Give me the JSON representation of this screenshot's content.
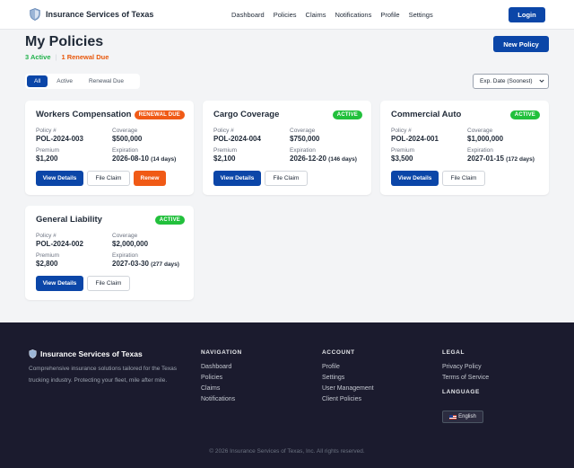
{
  "header": {
    "brand": "Insurance Services of Texas",
    "nav": [
      "Dashboard",
      "Policies",
      "Claims",
      "Notifications",
      "Profile",
      "Settings"
    ],
    "login_label": "Login"
  },
  "page": {
    "title": "My Policies",
    "active_count": "3 Active",
    "renewal_count": "1 Renewal Due",
    "new_policy_label": "New Policy"
  },
  "filters": {
    "tabs": [
      "All",
      "Active",
      "Renewal Due"
    ],
    "selected": "All",
    "sort_value": "Exp. Date (Soonest)"
  },
  "labels": {
    "policy_no": "Policy #",
    "coverage": "Coverage",
    "premium": "Premium",
    "expiration": "Expiration",
    "view_details": "View Details",
    "file_claim": "File Claim",
    "renew": "Renew"
  },
  "policies": [
    {
      "name": "Workers Compensation",
      "status": "RENEWAL DUE",
      "policy_no": "POL-2024-003",
      "coverage": "$500,000",
      "premium": "$1,200",
      "expiration": "2026-08-10",
      "days": "(14 days)"
    },
    {
      "name": "Cargo Coverage",
      "status": "ACTIVE",
      "policy_no": "POL-2024-004",
      "coverage": "$750,000",
      "premium": "$2,100",
      "expiration": "2026-12-20",
      "days": "(146 days)"
    },
    {
      "name": "Commercial Auto",
      "status": "ACTIVE",
      "policy_no": "POL-2024-001",
      "coverage": "$1,000,000",
      "premium": "$3,500",
      "expiration": "2027-01-15",
      "days": "(172 days)"
    },
    {
      "name": "General Liability",
      "status": "ACTIVE",
      "policy_no": "POL-2024-002",
      "coverage": "$2,000,000",
      "premium": "$2,800",
      "expiration": "2027-03-30",
      "days": "(277 days)"
    }
  ],
  "footer": {
    "brand": "Insurance Services of Texas",
    "description": "Comprehensive insurance solutions tailored for the Texas trucking industry. Protecting your fleet, mile after mile.",
    "navigation": {
      "heading": "NAVIGATION",
      "links": [
        "Dashboard",
        "Policies",
        "Claims",
        "Notifications"
      ]
    },
    "account": {
      "heading": "ACCOUNT",
      "links": [
        "Profile",
        "Settings",
        "User Management",
        "Client Policies"
      ]
    },
    "legal": {
      "heading": "LEGAL",
      "links": [
        "Privacy Policy",
        "Terms of Service"
      ]
    },
    "language": {
      "heading": "LANGUAGE",
      "button": "English"
    },
    "copyright": "© 2026 Insurance Services of Texas, Inc. All rights reserved."
  },
  "colors": {
    "primary": "#0b46a8",
    "active_green": "#22c03c",
    "renewal_orange": "#f05a16",
    "footer_bg": "#1b1b2e"
  }
}
